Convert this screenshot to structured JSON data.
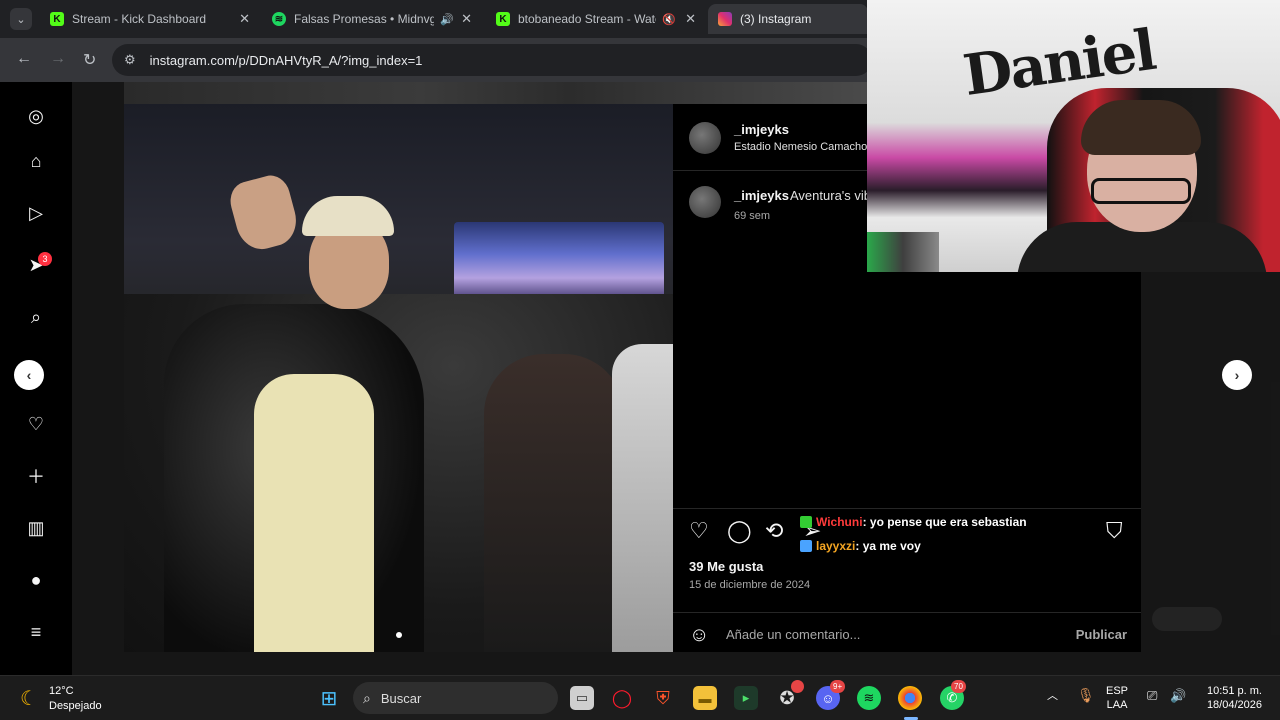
{
  "browser": {
    "tabs": [
      {
        "title": "Stream - Kick Dashboard",
        "favicon": "kick-icon",
        "color": "#53fc18"
      },
      {
        "title": "Falsas Promesas • Midnvght",
        "favicon": "spotify-icon",
        "color": "#1ed760",
        "audio": "🔊"
      },
      {
        "title": "btobaneado Stream - Watch",
        "favicon": "kick-icon",
        "color": "#53fc18",
        "audio": "🔇"
      },
      {
        "title": "(3) Instagram",
        "favicon": "instagram-icon",
        "color": "#e1306c"
      }
    ],
    "url": "instagram.com/p/DDnAHVtyR_A/?img_index=1"
  },
  "sidebar": {
    "notification_count": "3"
  },
  "post": {
    "author": "_imjeyks",
    "location": "Estadio Nemesio Camacho",
    "caption_user": "_imjeyks",
    "caption_text": "Aventura's vib",
    "caption_time": "69 sem",
    "likes": "39 Me gusta",
    "date": "15 de diciembre de 2024",
    "comment_placeholder": "Añade un comentario...",
    "publish_label": "Publicar"
  },
  "chat": [
    {
      "user": "Wichuni",
      "text": " : yo pense que era sebastian",
      "color": "#ff3b3b",
      "badge": "#33cc33"
    },
    {
      "user": "layyxzi",
      "text": " : ya me voy",
      "color": "#f5a623",
      "badge": "#4aa3ff"
    }
  ],
  "webcam": {
    "graffiti": "Daniel"
  },
  "taskbar": {
    "temperature": "12°C",
    "weather": "Despejado",
    "search_label": "Buscar",
    "discord_badge": "9+",
    "whatsapp_badge": "70",
    "language": "ESP",
    "layout": "LAA",
    "time": "10:51 p. m.",
    "date": "18/04/2026"
  }
}
